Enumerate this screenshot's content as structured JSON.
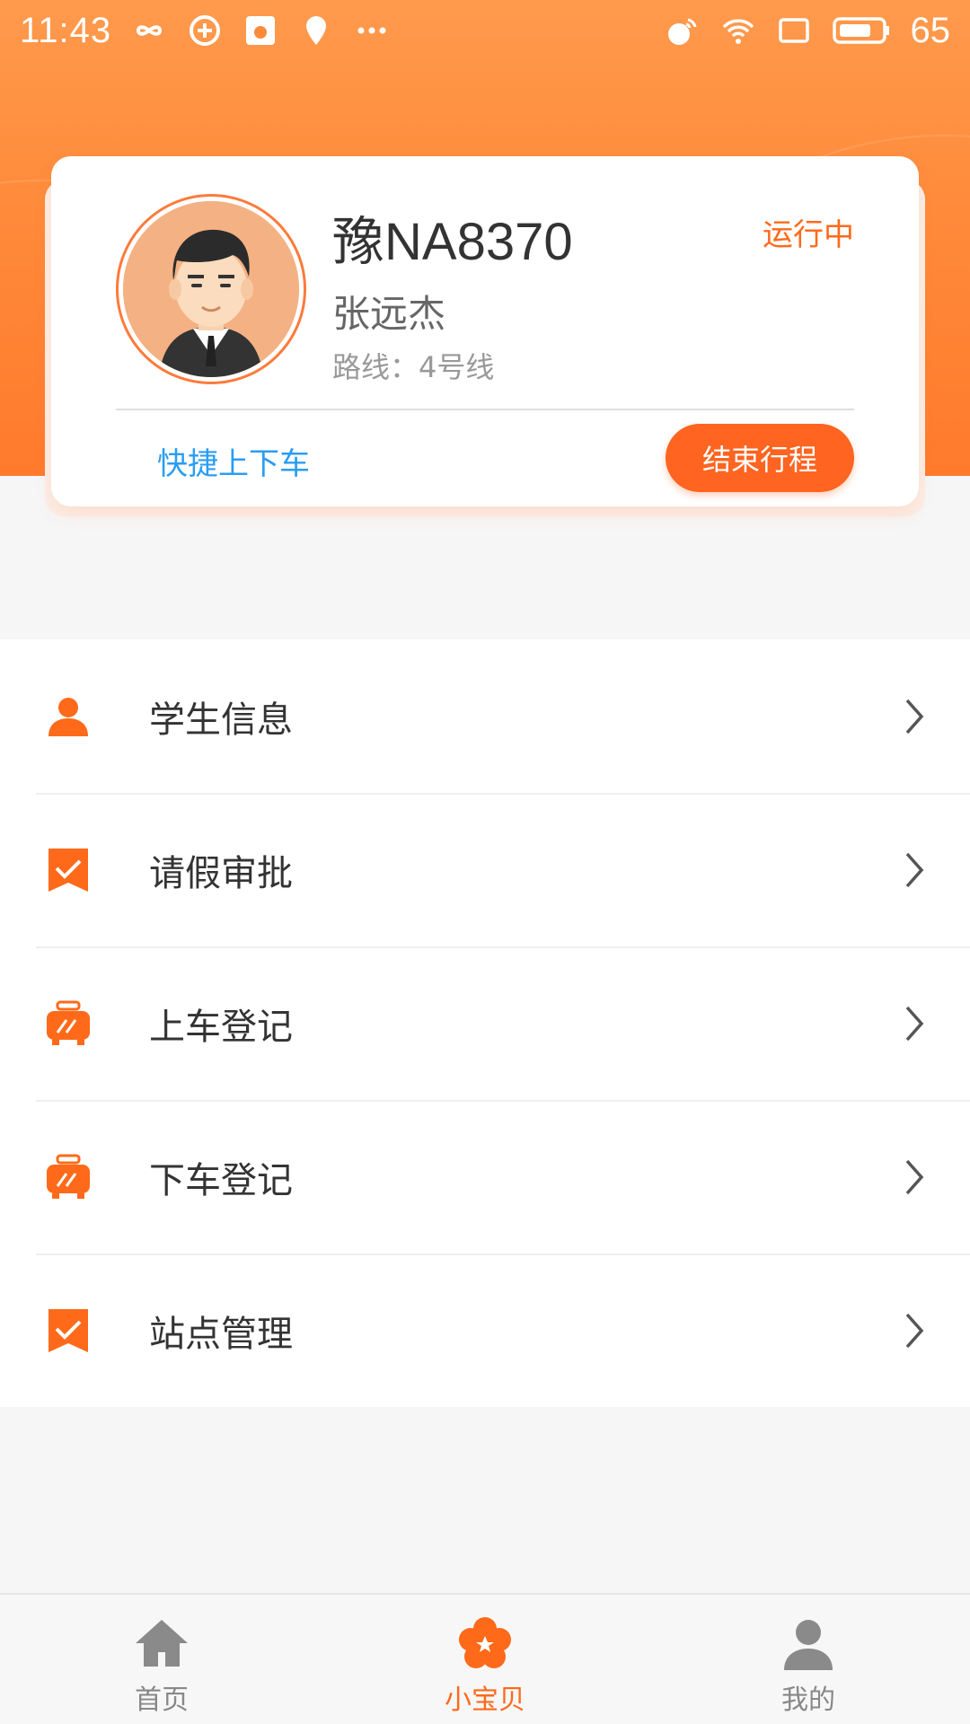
{
  "status_bar": {
    "time": "11:43",
    "battery": "65"
  },
  "card": {
    "plate": "豫NA8370",
    "status": "运行中",
    "driver": "张远杰",
    "route": "路线：4号线",
    "quick_link": "快捷上下车",
    "end_button": "结束行程"
  },
  "menu": {
    "items": [
      {
        "label": "学生信息",
        "icon": "person-icon"
      },
      {
        "label": "请假审批",
        "icon": "approval-icon"
      },
      {
        "label": "上车登记",
        "icon": "bus-icon"
      },
      {
        "label": "下车登记",
        "icon": "bus-icon"
      },
      {
        "label": "站点管理",
        "icon": "approval-icon"
      }
    ]
  },
  "tabbar": {
    "tabs": [
      {
        "label": "首页",
        "icon": "home-icon",
        "active": false
      },
      {
        "label": "小宝贝",
        "icon": "flower-icon",
        "active": true
      },
      {
        "label": "我的",
        "icon": "user-icon",
        "active": false
      }
    ]
  },
  "colors": {
    "accent": "#ff6420",
    "header": "#ff8a3a",
    "link": "#2a9df4"
  }
}
